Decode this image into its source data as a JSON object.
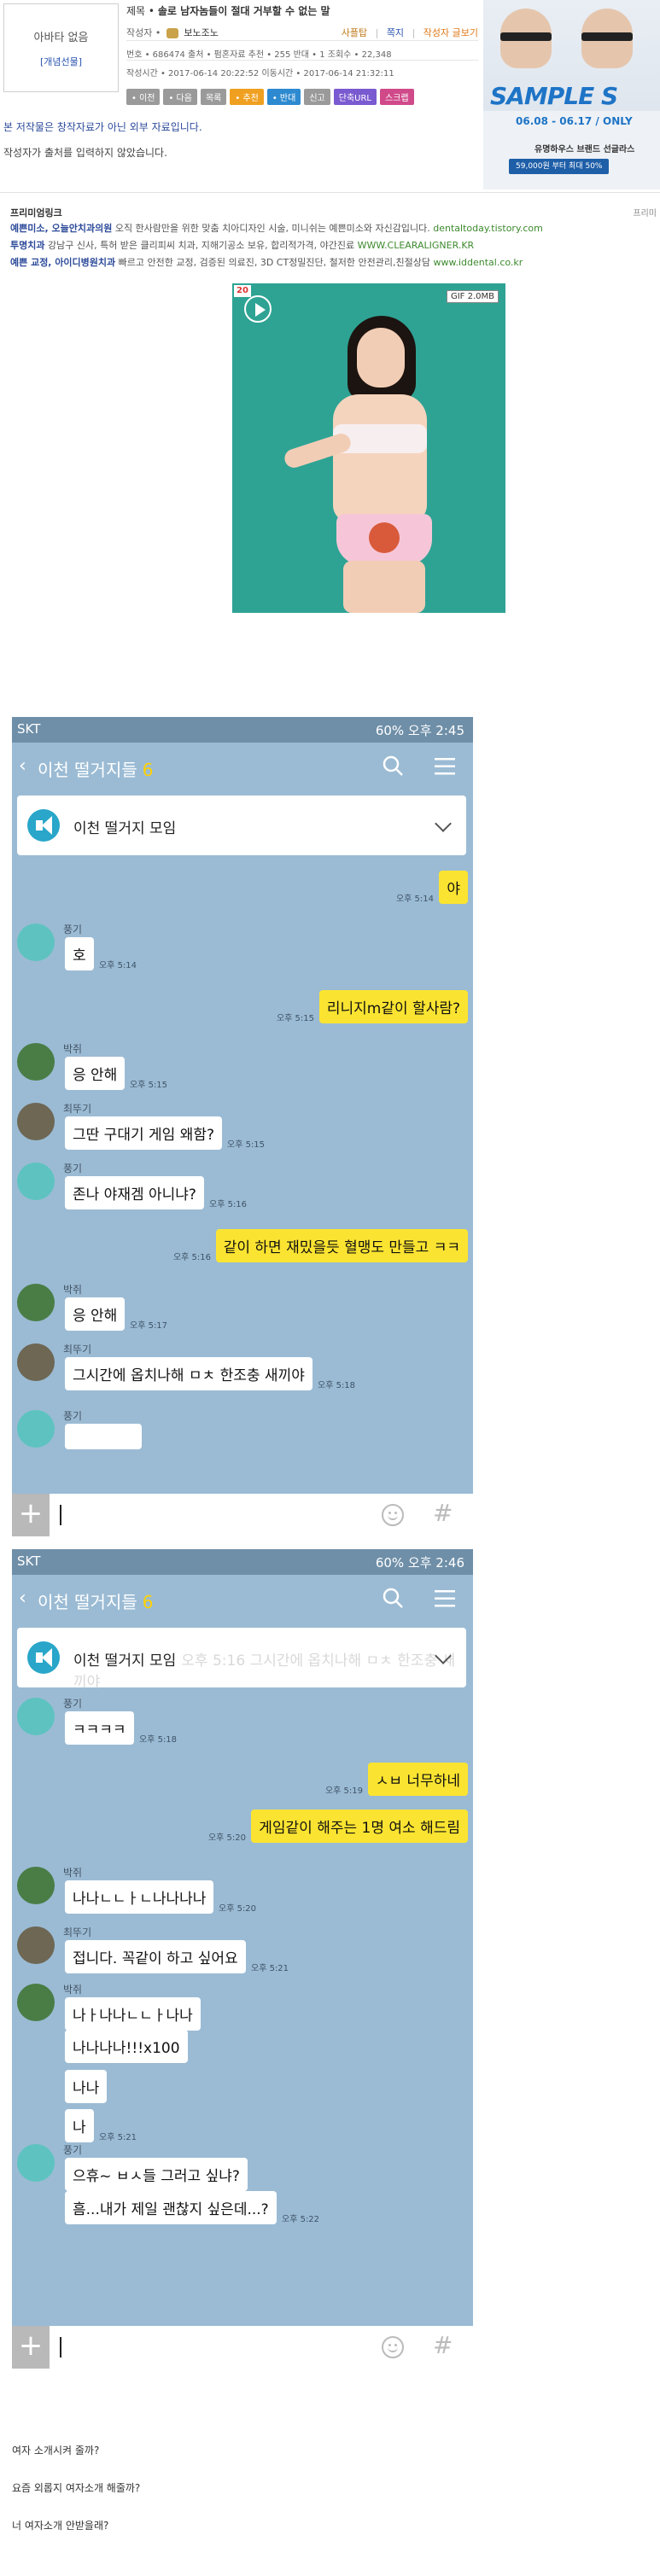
{
  "header": {
    "avatar_line1": "아바타 없음",
    "avatar_line2": "[개념선물]",
    "title_label": "제목 •",
    "title": "솔로 남자놈들이 절대 거부할 수 없는 말",
    "author_label": "작성자 •",
    "author": "보노조노",
    "links": [
      "사플탑",
      "쪽지",
      "작성자 글보기"
    ],
    "stats": "번호 • 686474   출처 • 펌혼자료   추천 • 255   반대 • 1   조회수 • 22,348",
    "times": "작성시간 • 2017-06-14 20:22:52   이동시간 • 2017-06-14 21:32:11",
    "buttons": [
      {
        "label": "• 이전",
        "color": "#9a9a9a"
      },
      {
        "label": "• 다음",
        "color": "#9a9a9a"
      },
      {
        "label": "목록",
        "color": "#9a9a9a"
      },
      {
        "label": "• 추천",
        "color": "#f0a020"
      },
      {
        "label": "• 반대",
        "color": "#2e8ad0"
      },
      {
        "label": "신고",
        "color": "#9a9a9a"
      },
      {
        "label": "단축URL",
        "color": "#7a5ad0"
      },
      {
        "label": "스크랩",
        "color": "#d04a8a"
      }
    ]
  },
  "ad": {
    "title": "SAMPLE S",
    "dates": "06.08 - 06.17 / ONLY",
    "brand": "유명하우스 브랜드 선글라스",
    "price": "59,000원 부터 최대 50%"
  },
  "notices": {
    "line1": "본 저작물은 창작자료가 아닌 외부 자료입니다.",
    "line2": "작성자가 출처를 입력하지 않았습니다."
  },
  "premium_links": {
    "title": "프리미엄링크",
    "right_label": "프리미",
    "rows": [
      {
        "advertiser": "예쁜미소, 오늘안치과의원",
        "text": " 오직 한사람만을 위한 맞춤 치아디자인 시술, 미니쉬는 예쁜미소와 자신감입니다.",
        "url": " dentaltoday.tistory.com"
      },
      {
        "advertiser": "투명치과",
        "text": " 강남구 신사, 특허 받은 클리피씨 치과, 지해기공소 보유, 합리적가격, 야간진료",
        "url": "  WWW.CLEARALIGNER.KR"
      },
      {
        "advertiser": "예쁜 교정, 아이디병원치과",
        "text": " 빠르고 안전한 교정, 검증된 의료진, 3D CT정밀진단, 철저한 안전관리,친절상담",
        "url": " www.iddental.co.kr"
      }
    ]
  },
  "gif": {
    "badge_num": "20",
    "size_label": "GIF 2.0MB"
  },
  "chat1": {
    "carrier": "SKT",
    "status_right": "60% 오후 2:45",
    "room": "이천 떨거지들",
    "count": "6",
    "notice": "이천 떨거지 모임",
    "notice_faded": ""
  },
  "chat2": {
    "carrier": "SKT",
    "status_right": "60% 오후 2:46",
    "room": "이천 떨거지들",
    "count": "6",
    "notice": "이천 떨거지 모임",
    "notice_faded": "오후 5:16  그시간에 옵치나해 ㅁㅊ 한조충 새끼야"
  },
  "messages1": [
    {
      "type": "me",
      "text": "야",
      "time": "오후 5:14"
    },
    {
      "type": "other",
      "name": "풍기",
      "text": "호",
      "time": "오후 5:14"
    },
    {
      "type": "me",
      "text": "리니지m같이 할사람?",
      "time": "오후 5:15"
    },
    {
      "type": "other",
      "name": "박쥐",
      "text": "응 안해",
      "time": "오후 5:15"
    },
    {
      "type": "other",
      "name": "최뚜기",
      "text": "그딴 구대기 게임 왜함?",
      "time": "오후 5:15"
    },
    {
      "type": "other",
      "name": "풍기",
      "text": "존나 야재겜 아니냐?",
      "time": "오후 5:16"
    },
    {
      "type": "me",
      "text": "같이 하면 재밌을듯  혈맹도 만들고 ㅋㅋ",
      "time": "오후 5:16"
    },
    {
      "type": "other",
      "name": "박쥐",
      "text": "응 안해",
      "time": "오후 5:17"
    },
    {
      "type": "other",
      "name": "최뚜기",
      "text": "그시간에 옵치나해 ㅁㅊ 한조충 새끼야",
      "time": "오후 5:18"
    },
    {
      "type": "other",
      "name": "풍기",
      "text": "",
      "time": ""
    }
  ],
  "messages2": [
    {
      "type": "other",
      "name": "풍기",
      "text": "ㅋㅋㅋㅋ",
      "time": "오후 5:18"
    },
    {
      "type": "me",
      "text": "ㅅㅂ 너무하네",
      "time": "오후 5:19"
    },
    {
      "type": "me",
      "text": "게임같이 해주는 1명 여소 해드림",
      "time": "오후 5:20"
    },
    {
      "type": "other",
      "name": "박쥐",
      "text": "나나ㄴㄴㅏㄴ나나나나",
      "time": "오후 5:20"
    },
    {
      "type": "other",
      "name": "최뚜기",
      "text": "접니다. 꼭같이 하고 싶어요",
      "time": "오후 5:21"
    },
    {
      "type": "other",
      "name": "박쥐",
      "text": "나ㅏ나나ㄴㄴㅏ나나",
      "time": ""
    },
    {
      "type": "other",
      "text": "나나나나!!!x100",
      "time": ""
    },
    {
      "type": "other",
      "text": "나나",
      "time": ""
    },
    {
      "type": "other",
      "text": "나",
      "time": "오후 5:21"
    },
    {
      "type": "other",
      "name": "풍기",
      "text": "으휴~ ㅂㅅ들 그러고 싶냐?",
      "time": ""
    },
    {
      "type": "other",
      "text": "흠...내가 제일 괜찮지 싶은데...?",
      "time": "오후 5:22"
    }
  ],
  "footer": [
    "여자 소개시켜 줄까?",
    "요즘 외롭지 여자소개 해줄까?",
    "너 여자소개 안받을래?"
  ]
}
